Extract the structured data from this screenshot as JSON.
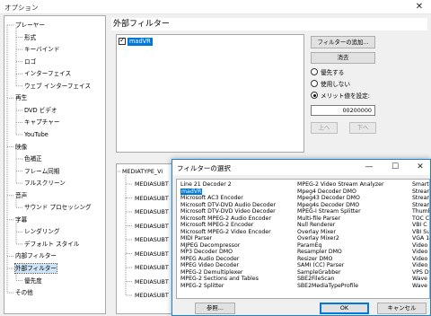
{
  "window": {
    "title": "オプション",
    "close_glyph": "✕"
  },
  "tree": {
    "items": [
      {
        "label": "プレーヤー",
        "level": 0
      },
      {
        "label": "形式",
        "level": 1
      },
      {
        "label": "キーバインド",
        "level": 1
      },
      {
        "label": "ロゴ",
        "level": 1
      },
      {
        "label": "インターフェイス",
        "level": 1
      },
      {
        "label": "ウェブ インターフェイス",
        "level": 1
      },
      {
        "label": "再生",
        "level": 0
      },
      {
        "label": "DVD ビデオ",
        "level": 1
      },
      {
        "label": "キャプチャー",
        "level": 1
      },
      {
        "label": "YouTube",
        "level": 1
      },
      {
        "label": "映像",
        "level": 0
      },
      {
        "label": "色補正",
        "level": 1
      },
      {
        "label": "フレーム同期",
        "level": 1
      },
      {
        "label": "フルスクリーン",
        "level": 1
      },
      {
        "label": "音声",
        "level": 0
      },
      {
        "label": "サウンド プロセッシング",
        "level": 1
      },
      {
        "label": "字幕",
        "level": 0
      },
      {
        "label": "レンダリング",
        "level": 1
      },
      {
        "label": "デフォルト スタイル",
        "level": 1
      },
      {
        "label": "内部フィルター",
        "level": 0
      },
      {
        "label": "外部フィルター",
        "level": 0,
        "selected": true
      },
      {
        "label": "優先度",
        "level": 1
      },
      {
        "label": "その他",
        "level": 0
      }
    ]
  },
  "panel": {
    "header": "外部フィルター",
    "filters": [
      {
        "name": "madVR",
        "checked": true
      }
    ],
    "add_button": "フィルターの追加...",
    "remove_button": "消去",
    "radio_prefer": "優先する",
    "radio_block": "使用しない",
    "radio_merit": "メリット値を設定:",
    "merit_value": "00200000",
    "up_button": "上へ",
    "down_button": "下へ",
    "mediatype_root": "MEDIATYPE_Vi",
    "mediatype_children": [
      "MEDIASUBT",
      "MEDIASUBT",
      "MEDIASUBT",
      "MEDIASUBT",
      "MEDIASUBT",
      "MEDIASUBT",
      "MEDIASUBT",
      "MEDIASUBT",
      "MEDIASUBT"
    ]
  },
  "dialog": {
    "title": "フィルターの選択",
    "minimize_glyph": "—",
    "maximize_glyph": "☐",
    "close_glyph": "✕",
    "col1": [
      "Line 21 Decoder 2",
      "madVR",
      "Microsoft AC3 Encoder",
      "Microsoft DTV-DVD Audio Decoder",
      "Microsoft DTV-DVD Video Decoder",
      "Microsoft MPEG-2 Audio Encoder",
      "Microsoft MPEG-2 Encoder",
      "Microsoft MPEG-2 Video Encoder",
      "MIDI Parser",
      "MJPEG Decompressor",
      "MP3 Decoder DMO",
      "MPEG Audio Decoder",
      "MPEG Video Decoder",
      "MPEG-2 Demultiplexer",
      "MPEG-2 Sections and Tables",
      "MPEG-2 Splitter"
    ],
    "col2": [
      "MPEG-2 Video Stream Analyzer",
      "Mpeg4 Decoder DMO",
      "Mpeg43 Decoder DMO",
      "Mpeg4s Decoder DMO",
      "MPEG-I Stream Splitter",
      "Multi-file Parser",
      "Null Renderer",
      "Overlay Mixer",
      "Overlay Mixer2",
      "ParamEq",
      "Resampler DMO",
      "Resizer DMO",
      "SAMI (CC) Parser",
      "SampleGrabber",
      "SBE2FileScan",
      "SBE2MediaTypeProfile"
    ],
    "col3": [
      "Smart",
      "Stream",
      "Stream",
      "Stream",
      "Thumb",
      "TOC C",
      "VBI C",
      "VBI Su",
      "VGA 1",
      "Video",
      "Video",
      "Video",
      "Video",
      "VPS D",
      "Wave",
      "Wave"
    ],
    "browse_button": "参照...",
    "ok_button": "OK",
    "cancel_button": "キャンセル"
  }
}
